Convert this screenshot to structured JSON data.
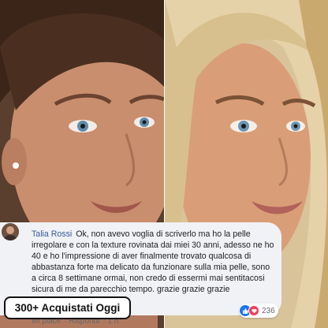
{
  "comment": {
    "author": "Talia Rossi",
    "text": "Ok, non avevo voglia di scriverlo ma ho la pelle irregolare e con la texture rovinata dai miei 30 anni, adesso ne ho 40 e ho l'impressione di aver finalmente trovato qualcosa di abbastanza forte ma delicato da funzionare sulla mia pelle, sono a circa 8 settimane ormai, non credo di essermi mai sentitacosi sicura di me da parecchio tempo. grazie grazie grazie",
    "actions": [
      "Mi piace",
      "Rispondi",
      "1 h"
    ],
    "reactions": {
      "count": "236",
      "icons": [
        "like-icon",
        "love-icon"
      ]
    }
  },
  "badge": {
    "label": "300+ Acquistati Oggi"
  }
}
